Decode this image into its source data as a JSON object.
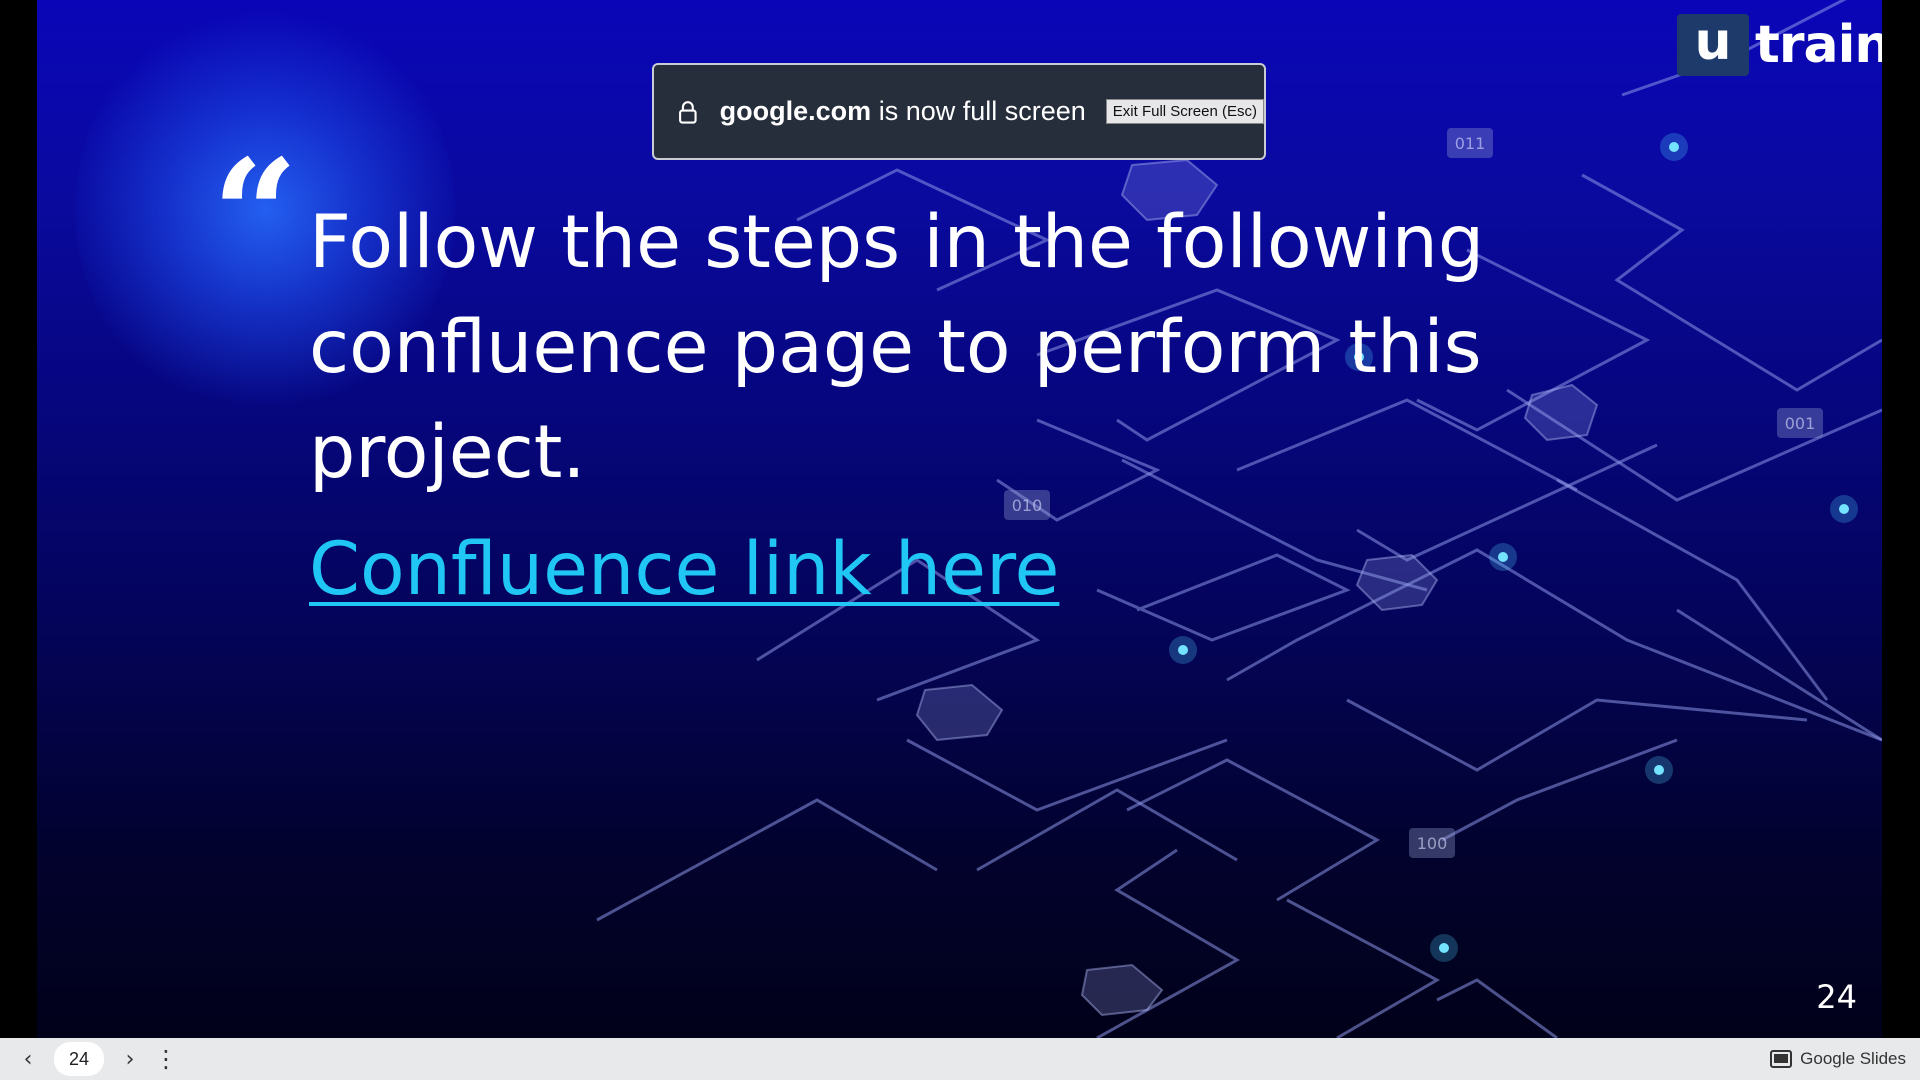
{
  "slide": {
    "quote_mark": "“",
    "quote_text": "Follow the steps in the following confluence page to perform this project.",
    "link_text": "Confluence link here",
    "slide_number": "24",
    "network_labels": [
      "011",
      "001",
      "010",
      "100"
    ]
  },
  "logo": {
    "box_letter": "u",
    "text": "train"
  },
  "fullscreen_toast": {
    "domain": "google.com",
    "message": "is now full screen",
    "exit_button": "Exit Full Screen (Esc)"
  },
  "bottom_bar": {
    "prev_icon": "‹",
    "next_icon": "›",
    "page_value": "24",
    "more_icon": "⋮",
    "brand_label": "Google Slides"
  },
  "colors": {
    "link": "#21c7f4",
    "slide_top": "#0a06b8",
    "slide_bottom": "#01011a",
    "toast_bg": "#262d3b"
  }
}
